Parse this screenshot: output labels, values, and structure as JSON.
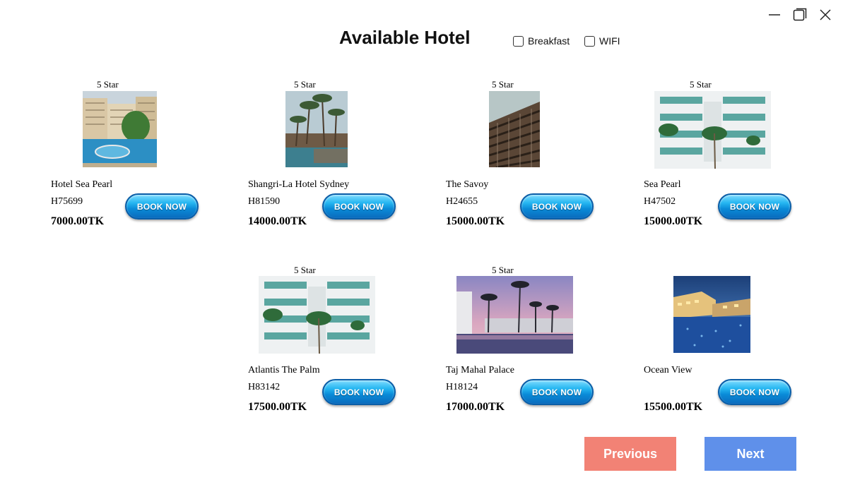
{
  "window": {
    "controls": [
      "minimize-icon",
      "maximize-icon",
      "close-icon"
    ]
  },
  "header": {
    "title": "Available Hotel"
  },
  "filters": {
    "breakfast": {
      "label": "Breakfast",
      "checked": false
    },
    "wifi": {
      "label": "WIFI",
      "checked": false
    }
  },
  "hotels": [
    {
      "stars": "5 Star",
      "name": "Hotel Sea Pearl",
      "code": "H75699",
      "price": "7000.00TK",
      "button": "BOOK NOW"
    },
    {
      "stars": "5 Star",
      "name": "Shangri-La Hotel Sydney",
      "code": "H81590",
      "price": "14000.00TK",
      "button": "BOOK NOW"
    },
    {
      "stars": "5 Star",
      "name": "The Savoy",
      "code": "H24655",
      "price": "15000.00TK",
      "button": "BOOK NOW"
    },
    {
      "stars": "5 Star",
      "name": "Sea Pearl",
      "code": "H47502",
      "price": "15000.00TK",
      "button": "BOOK NOW"
    },
    {
      "stars": "5 Star",
      "name": "Atlantis The Palm",
      "code": "H83142",
      "price": "17500.00TK",
      "button": "BOOK NOW"
    },
    {
      "stars": "5 Star",
      "name": "Taj Mahal Palace",
      "code": "H18124",
      "price": "17000.00TK",
      "button": "BOOK NOW"
    },
    {
      "stars": "",
      "name": "Ocean View",
      "code": "",
      "price": "15500.00TK",
      "button": "BOOK NOW"
    }
  ],
  "pagination": {
    "previous_label": "Previous",
    "next_label": "Next"
  },
  "colors": {
    "previous": "#f28275",
    "next": "#5f90ea",
    "book_button": "#0a8bd8"
  }
}
